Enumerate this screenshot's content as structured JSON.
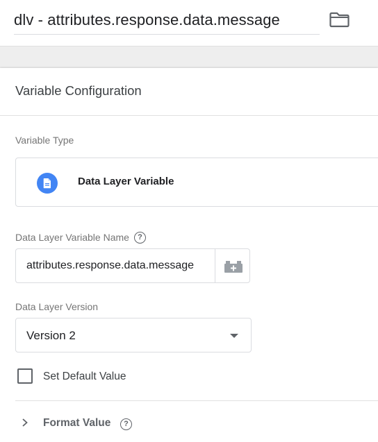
{
  "header": {
    "title": "dlv - attributes.response.data.message",
    "folder_icon": "folder-icon"
  },
  "card": {
    "title": "Variable Configuration",
    "variable_type": {
      "label": "Variable Type",
      "name": "Data Layer Variable",
      "icon": "document-icon",
      "icon_color": "#4285f4"
    },
    "name_field": {
      "label": "Data Layer Variable Name",
      "help": "?",
      "value": "attributes.response.data.message",
      "add_variable_icon": "lego-brick-plus-icon"
    },
    "version_field": {
      "label": "Data Layer Version",
      "selected": "Version 2"
    },
    "default_value": {
      "label": "Set Default Value",
      "checked": false
    },
    "format_value": {
      "label": "Format Value",
      "help": "?"
    }
  }
}
